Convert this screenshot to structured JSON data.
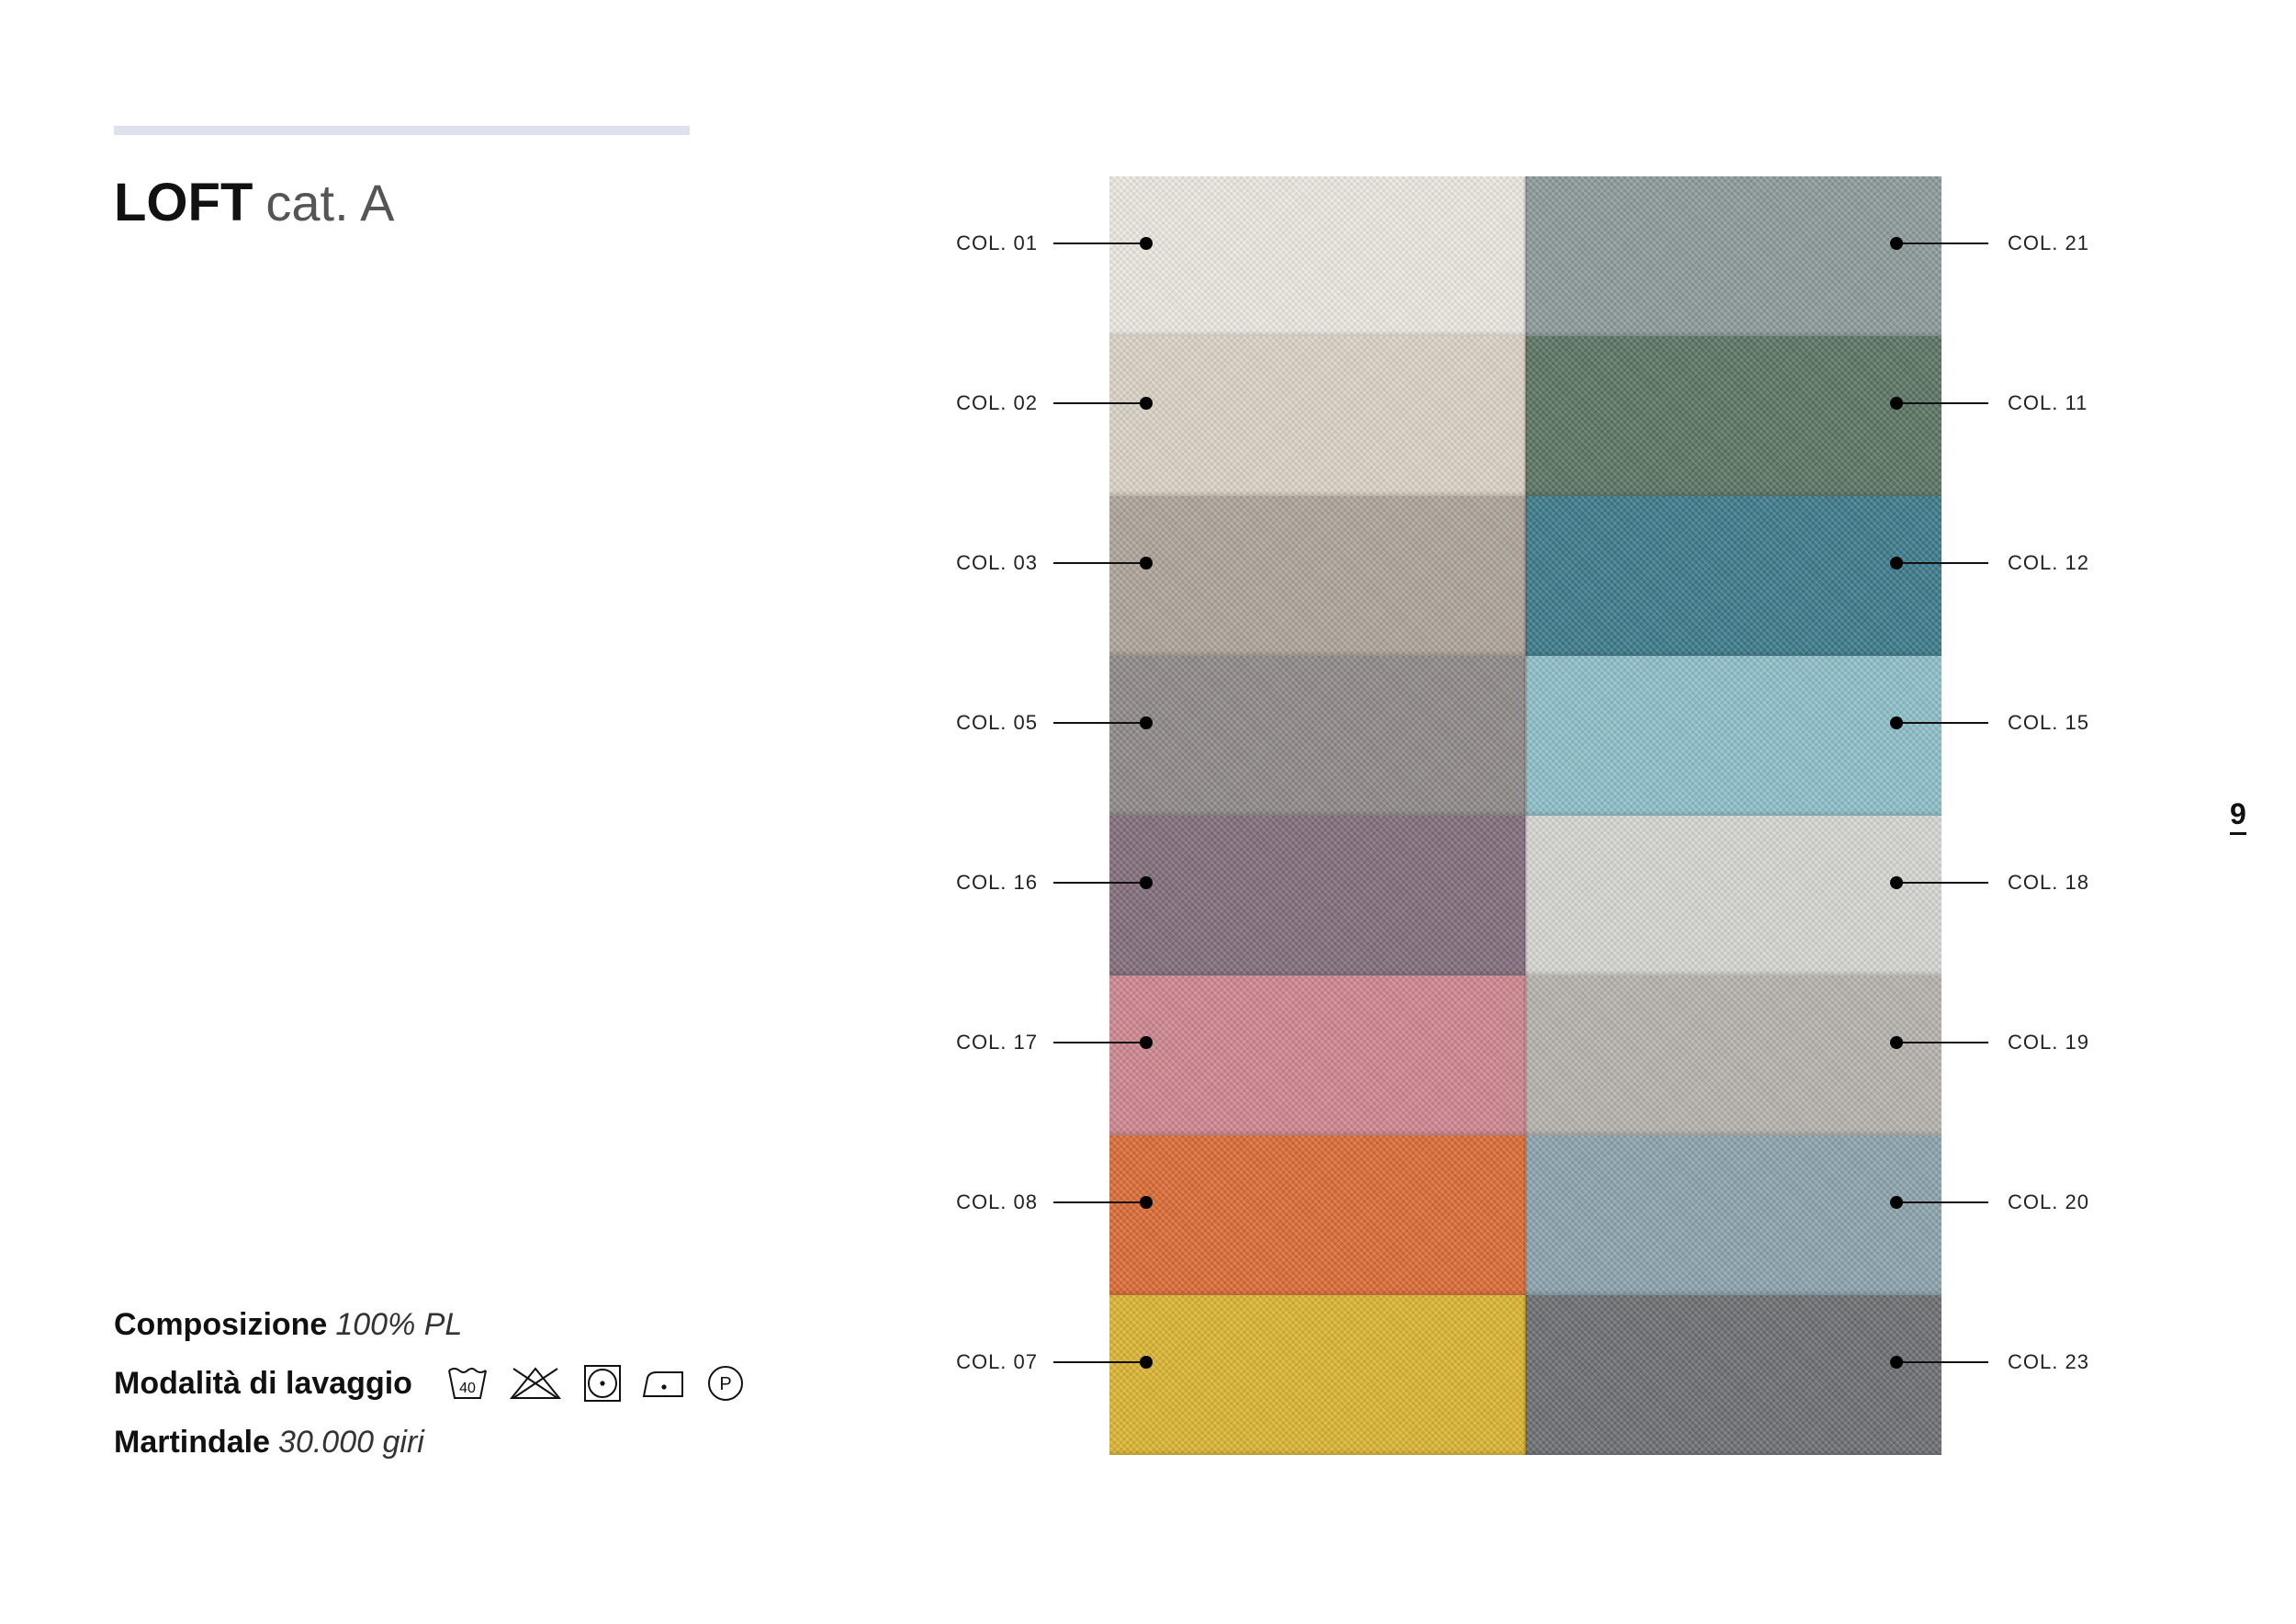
{
  "product": {
    "name": "LOFT",
    "category": "cat. A"
  },
  "specs": {
    "composition_label": "Composizione",
    "composition_value": "100% PL",
    "washing_label": "Modalità di lavaggio",
    "martindale_label": "Martindale",
    "martindale_value": "30.000 giri"
  },
  "care_icons": [
    {
      "name": "wash-40-icon",
      "text": "40"
    },
    {
      "name": "no-bleach-icon"
    },
    {
      "name": "tumble-dry-icon"
    },
    {
      "name": "iron-low-icon"
    },
    {
      "name": "dry-clean-p-icon",
      "text": "P"
    }
  ],
  "swatches_left": [
    {
      "label": "COL. 01",
      "color": "#ece9e1"
    },
    {
      "label": "COL. 02",
      "color": "#dcd3c5"
    },
    {
      "label": "COL. 03",
      "color": "#aea59a"
    },
    {
      "label": "COL. 05",
      "color": "#8f8a89"
    },
    {
      "label": "COL. 16",
      "color": "#826e7c"
    },
    {
      "label": "COL. 17",
      "color": "#cf8790"
    },
    {
      "label": "COL. 08",
      "color": "#dc6c35"
    },
    {
      "label": "COL. 07",
      "color": "#dcb532"
    }
  ],
  "swatches_right": [
    {
      "label": "COL. 21",
      "color": "#8d9b9b"
    },
    {
      "label": "COL. 11",
      "color": "#5a7563"
    },
    {
      "label": "COL. 12",
      "color": "#3d7b8b"
    },
    {
      "label": "COL. 15",
      "color": "#8ebfca"
    },
    {
      "label": "COL. 18",
      "color": "#d6d6d3"
    },
    {
      "label": "COL. 19",
      "color": "#b7b3ad"
    },
    {
      "label": "COL. 20",
      "color": "#8ba4ad"
    },
    {
      "label": "COL. 23",
      "color": "#6d6f72"
    }
  ],
  "page_number": "9"
}
